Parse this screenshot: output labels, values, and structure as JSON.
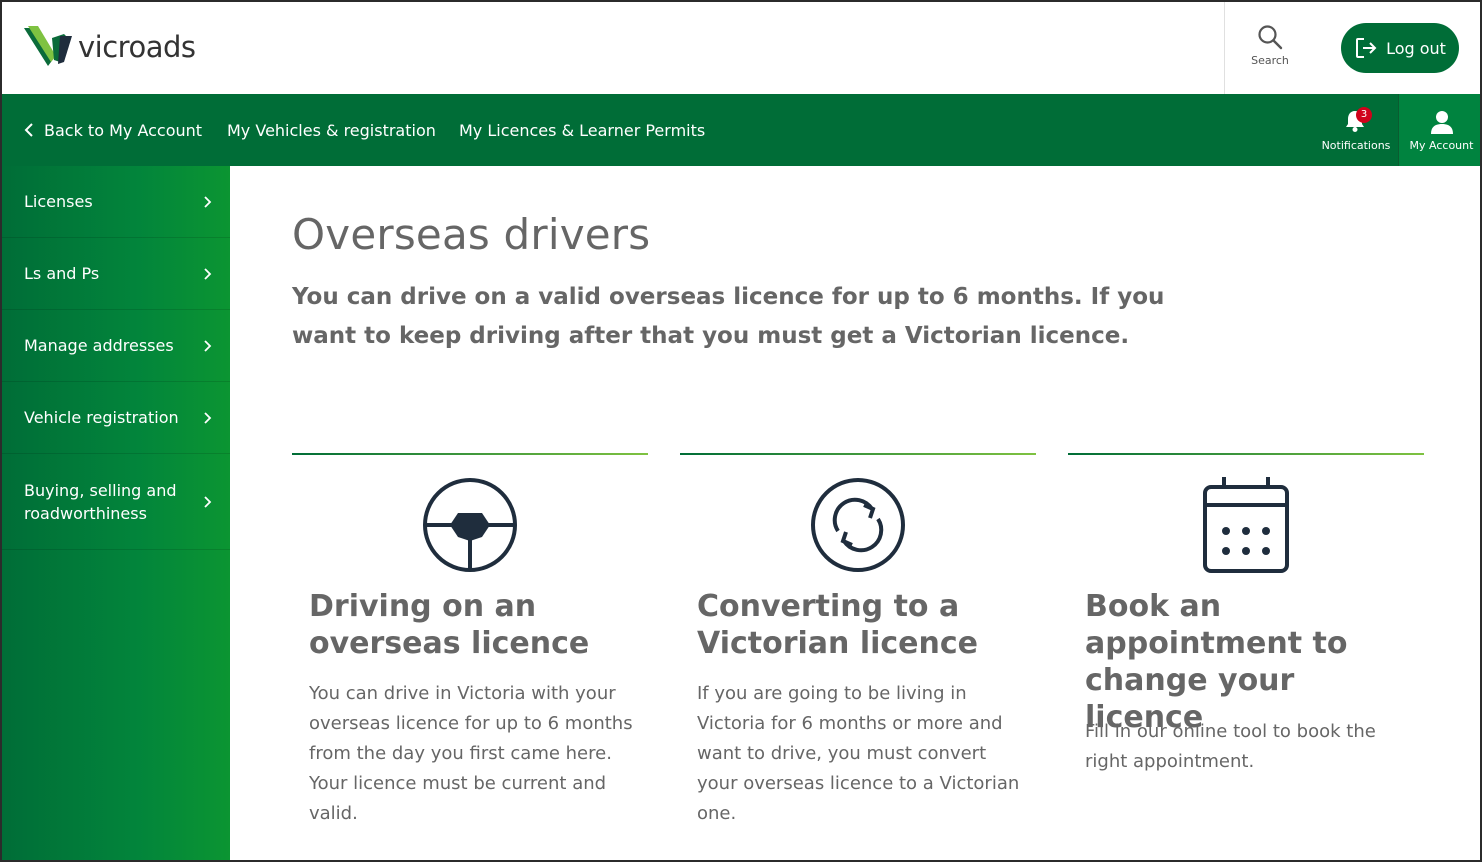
{
  "header": {
    "logo_text": "vicroads",
    "search_label": "Search",
    "logout_label": "Log out"
  },
  "nav": {
    "back_label": "Back to My Account",
    "vehicles_label": "My Vehicles & registration",
    "licences_label": "My Licences & Learner Permits",
    "notifications_label": "Notifications",
    "notifications_count": "3",
    "account_label": "My Account"
  },
  "sidebar": {
    "items": [
      {
        "label": "Licenses"
      },
      {
        "label": "Ls and Ps"
      },
      {
        "label": "Manage addresses"
      },
      {
        "label": "Vehicle registration"
      },
      {
        "label": "Buying, selling and roadworthiness"
      }
    ]
  },
  "main": {
    "title": "Overseas drivers",
    "intro": "You can drive on a valid overseas licence for up to 6 months. If you want to keep driving after that you must get a Victorian licence.",
    "cards": [
      {
        "icon": "steering-wheel-icon",
        "title": "Driving on an overseas licence",
        "text": "You can drive in Victoria with your overseas licence for up to 6 months from the day you first came here. Your licence must be current and valid."
      },
      {
        "icon": "convert-arrows-icon",
        "title": "Converting to a Victorian licence",
        "text": "If you are going to be living in Victoria for 6 months or more and want to drive, you must convert your overseas licence to a Victorian one."
      },
      {
        "icon": "calendar-icon",
        "title": "Book an appointment to change your licence",
        "text": "Fill in our online tool to book the right appointment."
      }
    ]
  },
  "colors": {
    "brand_green": "#006d37",
    "accent_green": "#7fc241",
    "badge_red": "#d0021b",
    "icon_navy": "#1f2d3d"
  }
}
